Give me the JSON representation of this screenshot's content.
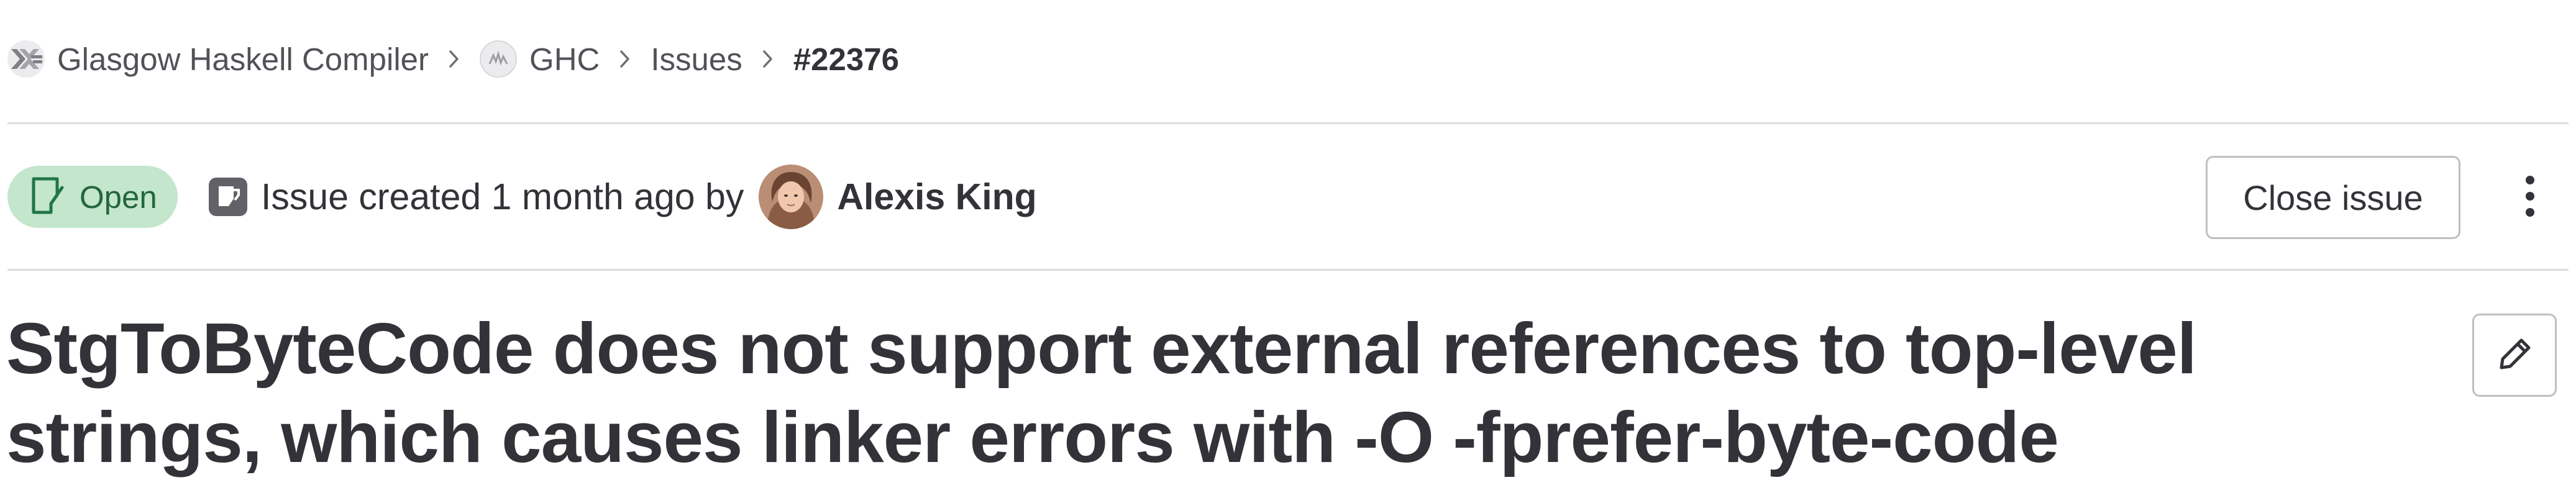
{
  "breadcrumb": {
    "items": [
      {
        "label": "Glasgow Haskell Compiler",
        "icon": "group-avatar-icon"
      },
      {
        "label": "GHC",
        "icon": "project-avatar-icon"
      },
      {
        "label": "Issues"
      }
    ],
    "current": "#22376",
    "separator_icon": "chevron-right-icon"
  },
  "issue": {
    "status": "Open",
    "status_icon": "issue-open-icon",
    "type_icon": "issue-type-icon",
    "meta_prefix": "Issue created",
    "created_ago": "1 month ago",
    "by_label": "by",
    "author": "Alexis King",
    "close_label": "Close issue",
    "more_actions_icon": "ellipsis-v-icon",
    "title": "StgToByteCode does not support external references to top-level strings, which causes linker errors with -O -fprefer-byte-code",
    "edit_icon": "pencil-icon"
  },
  "colors": {
    "status_badge_bg": "#c3e6cd",
    "status_badge_text": "#24663b",
    "text_primary": "#333238",
    "text_secondary": "#535158",
    "divider": "#dcdcde",
    "button_border": "#bfbfc3"
  }
}
